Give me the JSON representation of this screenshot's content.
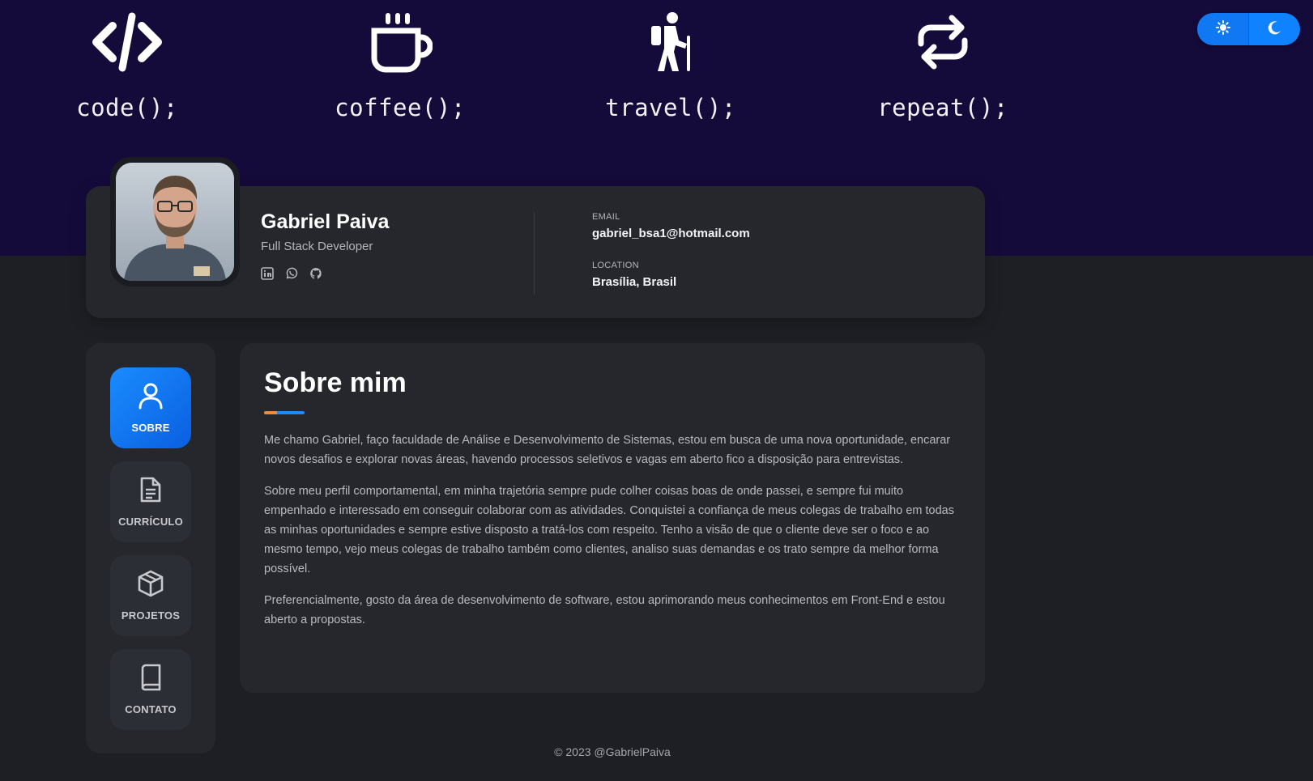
{
  "banner": {
    "mottos": [
      {
        "label": "code();",
        "icon": "code-icon"
      },
      {
        "label": "coffee();",
        "icon": "coffee-cup-icon"
      },
      {
        "label": "travel();",
        "icon": "hiker-icon"
      },
      {
        "label": "repeat();",
        "icon": "repeat-icon"
      }
    ]
  },
  "theme_toggle": {
    "light_icon": "sun-icon",
    "dark_icon": "moon-icon",
    "active": "light"
  },
  "profile": {
    "name": "Gabriel Paiva",
    "role": "Full Stack Developer",
    "socials": [
      {
        "icon": "linkedin-icon"
      },
      {
        "icon": "whatsapp-icon"
      },
      {
        "icon": "github-icon"
      }
    ],
    "email_label": "EMAIL",
    "email": "gabriel_bsa1@hotmail.com",
    "location_label": "LOCATION",
    "location": "Brasília, Brasil"
  },
  "nav": {
    "items": [
      {
        "label": "SOBRE",
        "icon": "user-icon",
        "active": true
      },
      {
        "label": "CURRÍCULO",
        "icon": "document-icon",
        "active": false
      },
      {
        "label": "PROJETOS",
        "icon": "cube-icon",
        "active": false
      },
      {
        "label": "CONTATO",
        "icon": "book-icon",
        "active": false
      }
    ]
  },
  "about": {
    "title": "Sobre mim",
    "paragraphs": [
      "Me chamo Gabriel, faço faculdade de Análise e Desenvolvimento de Sistemas, estou em busca de uma nova oportunidade, encarar novos desafios e explorar novas áreas, havendo processos seletivos e vagas em aberto fico a disposição para entrevistas.",
      "Sobre meu perfil comportamental, em minha trajetória sempre pude colher coisas boas de onde passei, e sempre fui muito empenhado e interessado em conseguir colaborar com as atividades. Conquistei a confiança de meus colegas de trabalho em todas as minhas oportunidades e sempre estive disposto a tratá-los com respeito. Tenho a visão de que o cliente deve ser o foco e ao mesmo tempo, vejo meus colegas de trabalho também como clientes, analiso suas demandas e os trato sempre da melhor forma possível.",
      "Preferencialmente, gosto da área de desenvolvimento de software, estou aprimorando meus conhecimentos em Front-End e estou aberto a propostas."
    ]
  },
  "footer": {
    "text": "© 2023 @GabrielPaiva"
  },
  "colors": {
    "banner": "#150b3b",
    "background": "#1e1f24",
    "card": "#25272d",
    "accent_blue": "#1a8cff",
    "accent_orange": "#f28a3a"
  }
}
